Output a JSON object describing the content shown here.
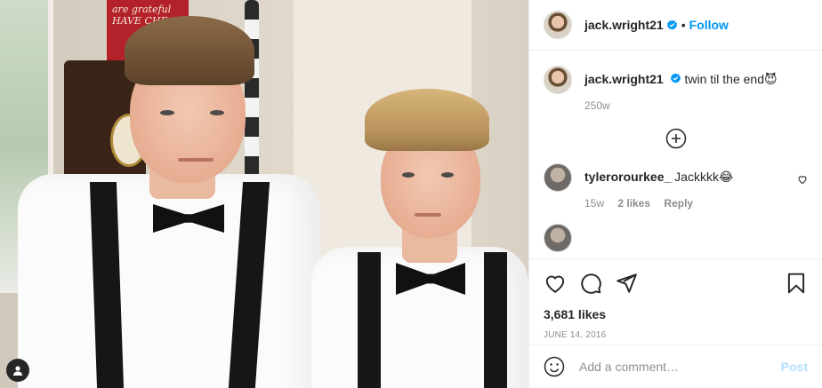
{
  "photo": {
    "alt": "",
    "sign_text": "are grateful HAVE CHE"
  },
  "header": {
    "username": "jack.wright21",
    "verified_icon": "verified-badge-icon",
    "separator": "•",
    "follow_label": "Follow"
  },
  "caption": {
    "username": "jack.wright21",
    "text": "twin til the end",
    "emoji": "😈",
    "age": "250w"
  },
  "comments": [
    {
      "username": "tylerorourkee_",
      "text": "Jackkkk",
      "emoji": "😂",
      "age": "15w",
      "likes": "2 likes",
      "reply_label": "Reply"
    }
  ],
  "actions": {
    "like_count": "3,681 likes",
    "date": "JUNE 14, 2016"
  },
  "add_comment": {
    "placeholder": "Add a comment…",
    "post_label": "Post"
  },
  "colors": {
    "accent": "#0095f6",
    "post_disabled": "#b2dffc",
    "muted": "#8e8e8e"
  }
}
